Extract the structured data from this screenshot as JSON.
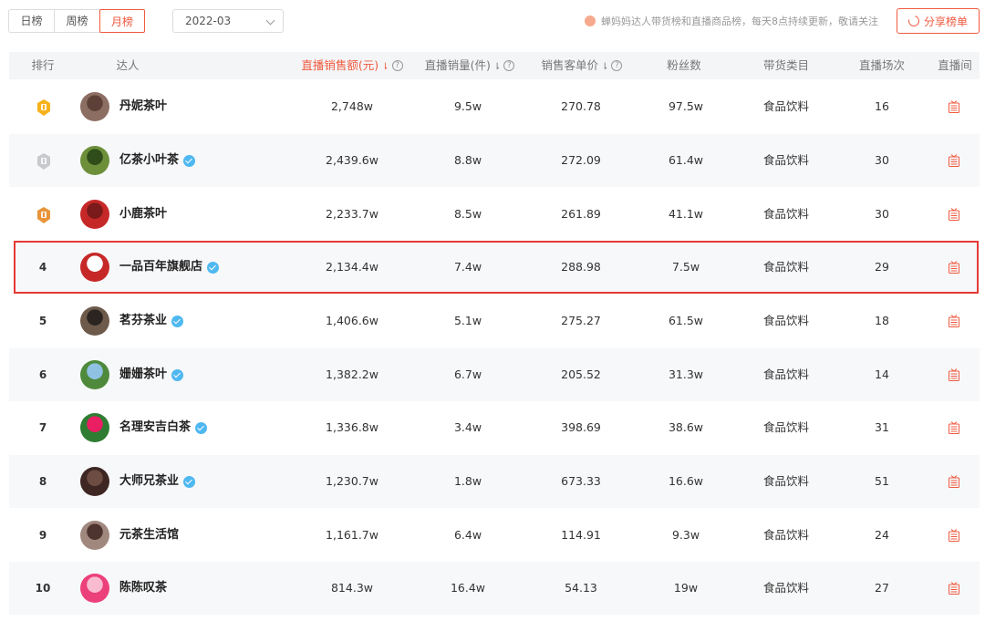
{
  "toolbar": {
    "tabs": [
      {
        "label": "日榜"
      },
      {
        "label": "周榜"
      },
      {
        "label": "月榜"
      }
    ],
    "active_tab": "月榜",
    "date_value": "2022-03",
    "notice": "蝉妈妈达人带货榜和直播商品榜，每天8点持续更新，敬请关注",
    "share_label": "分享榜单"
  },
  "table": {
    "headers": {
      "rank": "排行",
      "talent": "达人",
      "sales_amount": "直播销售额(元)",
      "sales_volume": "直播销量(件)",
      "unit_price": "销售客单价",
      "fans": "粉丝数",
      "category": "带货类目",
      "live_count": "直播场次",
      "live_room": "直播间"
    },
    "rows": [
      {
        "rank": "1",
        "name": "丹妮茶叶",
        "verified": false,
        "amount": "2,748w",
        "volume": "9.5w",
        "price": "270.78",
        "fans": "97.5w",
        "category": "食品饮料",
        "sessions": "16"
      },
      {
        "rank": "2",
        "name": "亿茶小叶茶",
        "verified": true,
        "amount": "2,439.6w",
        "volume": "8.8w",
        "price": "272.09",
        "fans": "61.4w",
        "category": "食品饮料",
        "sessions": "30"
      },
      {
        "rank": "3",
        "name": "小鹿茶叶",
        "verified": false,
        "amount": "2,233.7w",
        "volume": "8.5w",
        "price": "261.89",
        "fans": "41.1w",
        "category": "食品饮料",
        "sessions": "30"
      },
      {
        "rank": "4",
        "name": "一品百年旗舰店",
        "verified": true,
        "amount": "2,134.4w",
        "volume": "7.4w",
        "price": "288.98",
        "fans": "7.5w",
        "category": "食品饮料",
        "sessions": "29"
      },
      {
        "rank": "5",
        "name": "茗芬茶业",
        "verified": true,
        "amount": "1,406.6w",
        "volume": "5.1w",
        "price": "275.27",
        "fans": "61.5w",
        "category": "食品饮料",
        "sessions": "18"
      },
      {
        "rank": "6",
        "name": "姗姗茶叶",
        "verified": true,
        "amount": "1,382.2w",
        "volume": "6.7w",
        "price": "205.52",
        "fans": "31.3w",
        "category": "食品饮料",
        "sessions": "14"
      },
      {
        "rank": "7",
        "name": "名理安吉白茶",
        "verified": true,
        "amount": "1,336.8w",
        "volume": "3.4w",
        "price": "398.69",
        "fans": "38.6w",
        "category": "食品饮料",
        "sessions": "31"
      },
      {
        "rank": "8",
        "name": "大师兄茶业",
        "verified": true,
        "amount": "1,230.7w",
        "volume": "1.8w",
        "price": "673.33",
        "fans": "16.6w",
        "category": "食品饮料",
        "sessions": "51"
      },
      {
        "rank": "9",
        "name": "元茶生活馆",
        "verified": false,
        "amount": "1,161.7w",
        "volume": "6.4w",
        "price": "114.91",
        "fans": "9.3w",
        "category": "食品饮料",
        "sessions": "24"
      },
      {
        "rank": "10",
        "name": "陈陈叹茶",
        "verified": false,
        "amount": "814.3w",
        "volume": "16.4w",
        "price": "54.13",
        "fans": "19w",
        "category": "食品饮料",
        "sessions": "27"
      }
    ]
  },
  "colors": {
    "accent": "#f05a3e",
    "gold": "#f5b21b",
    "silver": "#c7c9cc",
    "bronze": "#e8953a",
    "verified": "#4fb8f0",
    "highlight_border": "#e53935"
  },
  "icons": [
    "medal-gold-icon",
    "medal-silver-icon",
    "medal-bronze-icon",
    "verified-icon",
    "live-room-icon",
    "help-icon",
    "share-icon",
    "chevron-down-icon"
  ]
}
